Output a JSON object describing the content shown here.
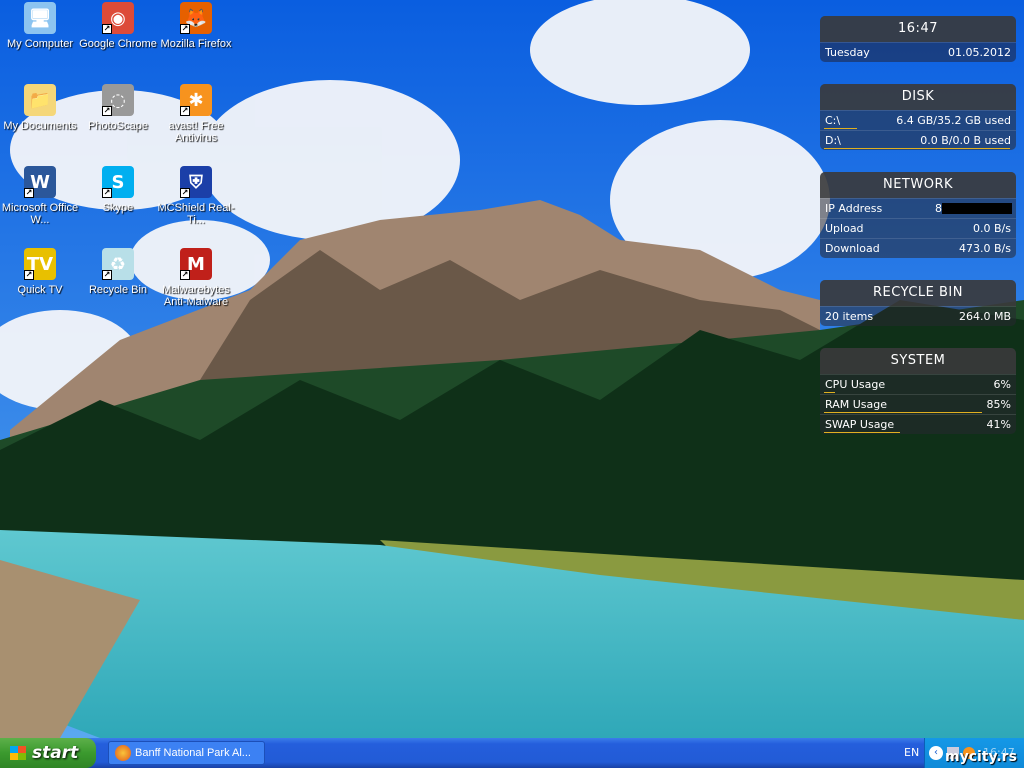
{
  "desktop": {
    "icons": [
      {
        "label": "My Computer",
        "icon": "computer-icon",
        "color": "#8cc4f0",
        "glyph": "🖥"
      },
      {
        "label": "Google Chrome",
        "icon": "chrome-icon",
        "color": "#dd4b39",
        "glyph": "◉"
      },
      {
        "label": "Mozilla Firefox",
        "icon": "firefox-icon",
        "color": "#e66000",
        "glyph": "🦊"
      },
      {
        "label": "My Documents",
        "icon": "folder-icon",
        "color": "#f5d77a",
        "glyph": "📁"
      },
      {
        "label": "PhotoScape",
        "icon": "photoscape-icon",
        "color": "#999999",
        "glyph": "◌"
      },
      {
        "label": "avast! Free Antivirus",
        "icon": "avast-icon",
        "color": "#f7931e",
        "glyph": "✱"
      },
      {
        "label": "Microsoft Office W...",
        "icon": "word-icon",
        "color": "#2b579a",
        "glyph": "W"
      },
      {
        "label": "Skype",
        "icon": "skype-icon",
        "color": "#00aff0",
        "glyph": "S"
      },
      {
        "label": "MCShield Real-Ti...",
        "icon": "shield-icon",
        "color": "#1b3fa8",
        "glyph": "⛨"
      },
      {
        "label": "Quick TV",
        "icon": "tv-icon",
        "color": "#e8c000",
        "glyph": "TV"
      },
      {
        "label": "Recycle Bin",
        "icon": "recycle-bin-icon",
        "color": "#b8dfe8",
        "glyph": "♻"
      },
      {
        "label": "Malwarebytes Anti-Malware",
        "icon": "malwarebytes-icon",
        "color": "#c0201a",
        "glyph": "M"
      }
    ]
  },
  "clock": {
    "time": "16:47",
    "day": "Tuesday",
    "date": "01.05.2012"
  },
  "disk": {
    "title": "DISK",
    "rows": [
      {
        "label": "C:\\",
        "value": "6.4 GB/35.2 GB used",
        "fill": 0.18
      },
      {
        "label": "D:\\",
        "value": "0.0 B/0.0 B used",
        "fill": 1.0
      }
    ]
  },
  "network": {
    "title": "NETWORK",
    "ip_label": "IP Address",
    "ip_value": "8",
    "upload_label": "Upload",
    "upload": "0.0 B/s",
    "download_label": "Download",
    "download": "473.0 B/s"
  },
  "recycle": {
    "title": "RECYCLE BIN",
    "items": "20 items",
    "size": "264.0 MB"
  },
  "system": {
    "title": "SYSTEM",
    "rows": [
      {
        "label": "CPU Usage",
        "value": "6%",
        "fill": 0.06
      },
      {
        "label": "RAM Usage",
        "value": "85%",
        "fill": 0.85
      },
      {
        "label": "SWAP Usage",
        "value": "41%",
        "fill": 0.41
      }
    ]
  },
  "taskbar": {
    "start": "start",
    "task": "Banff National Park Al...",
    "lang": "EN",
    "time": "16:47",
    "watermark": "mycity.rs"
  }
}
